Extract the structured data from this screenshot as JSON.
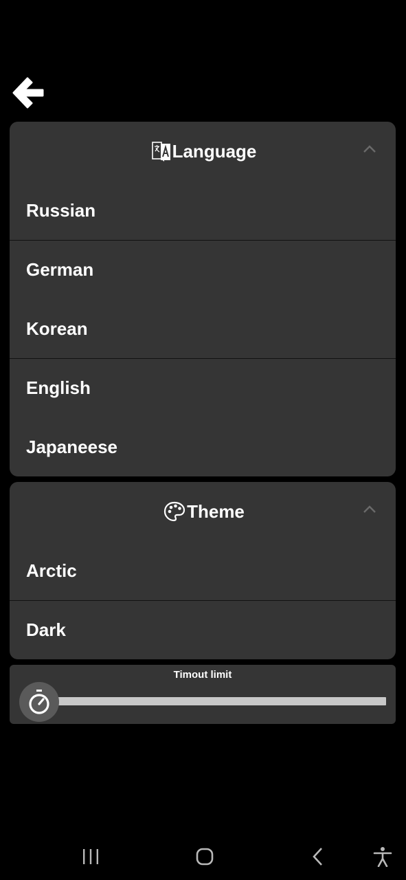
{
  "header": {
    "back_icon": "arrow-left-icon"
  },
  "language_section": {
    "title": "Language",
    "icon": "translate-icon",
    "chevron_icon": "chevron-up-icon",
    "items": [
      {
        "label": "Russian"
      },
      {
        "label": "German"
      },
      {
        "label": "Korean"
      },
      {
        "label": "English"
      },
      {
        "label": "Japaneese"
      }
    ]
  },
  "theme_section": {
    "title": "Theme",
    "icon": "palette-icon",
    "chevron_icon": "chevron-up-icon",
    "items": [
      {
        "label": "Arctic"
      },
      {
        "label": "Dark"
      }
    ]
  },
  "timeout": {
    "label": "Timout limit",
    "icon": "stopwatch-icon",
    "value_fraction": 0
  },
  "navbar": {
    "recents_icon": "recents-icon",
    "home_icon": "home-icon",
    "back_icon": "nav-back-icon",
    "accessibility_icon": "accessibility-icon"
  },
  "colors": {
    "background": "#000000",
    "card": "#353535",
    "text": "#ffffff",
    "slider_track": "#c8c8c8",
    "slider_thumb": "#5a5a5a"
  }
}
